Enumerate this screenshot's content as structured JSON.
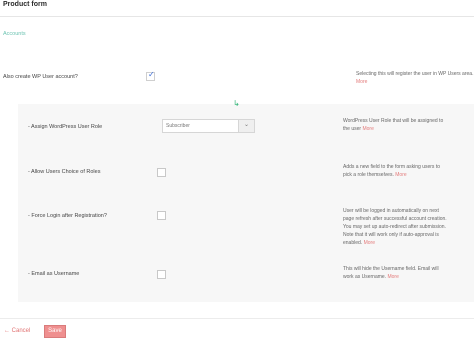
{
  "header": {
    "title": "Product form"
  },
  "section": {
    "link": "Accounts"
  },
  "create_account": {
    "label": "Also create WP User account?",
    "checked": true,
    "help": "Selecting this will register the user in WP Users area.",
    "more": "More"
  },
  "rows": [
    {
      "label": "- Assign WordPress User Role",
      "control": "select",
      "value": "Subscriber",
      "help_lines": [
        "WordPress User Role that will be assigned to",
        "the user"
      ],
      "more": "More"
    },
    {
      "label": "- Allow Users Choice of Roles",
      "control": "checkbox",
      "checked": false,
      "help_lines": [
        "Adds a new field to the form asking users to",
        "pick a role themselves."
      ],
      "more": "More"
    },
    {
      "label": "- Force Login after Registration?",
      "control": "checkbox",
      "checked": false,
      "help_lines": [
        "User will be logged in automatically on next",
        "page refresh after successful account creation.",
        "You may set up auto-redirect after submission.",
        "Note that it will work only if auto-approval is",
        "enabled."
      ],
      "more": "More"
    },
    {
      "label": "- Email as Username",
      "control": "checkbox",
      "checked": false,
      "help_lines": [
        "This will hide the Username field. Email will",
        "work as Username."
      ],
      "more": "More"
    }
  ],
  "footer": {
    "cancel": "Cancel",
    "save": "Save"
  },
  "icons": {
    "arrow": "turn-down-arrow-icon",
    "check": "checkmark-icon",
    "chevron": "chevron-down-icon",
    "back": "arrow-left-icon"
  },
  "colors": {
    "accent": "#6cc3b1",
    "link": "#e37b7b",
    "save": "#ef8f8f",
    "check": "#3f6fd8"
  }
}
